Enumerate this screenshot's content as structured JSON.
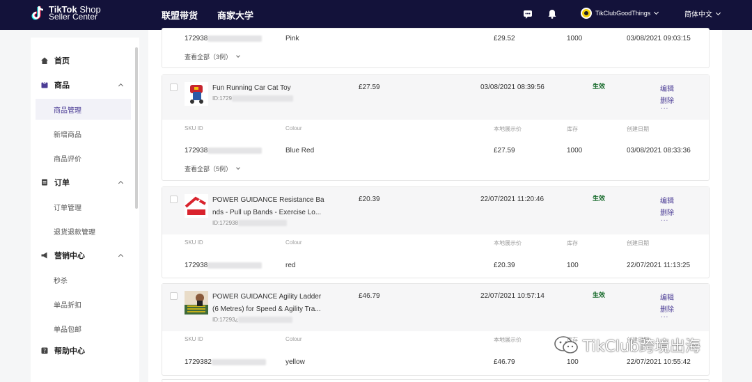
{
  "topbar": {
    "logo_line1_bold": "TikTok",
    "logo_line1_rest": " Shop",
    "logo_line2": "Seller Center",
    "nav": [
      "联盟带货",
      "商家大学"
    ],
    "account_name": "TikClubGoodThings",
    "language": "简体中文",
    "icons": [
      "message-icon",
      "bell-icon"
    ]
  },
  "sidebar": {
    "groups": [
      {
        "label": "首页",
        "icon": "home-icon"
      },
      {
        "label": "商品",
        "icon": "product-icon"
      },
      {
        "label": "订单",
        "icon": "order-icon"
      },
      {
        "label": "营销中心",
        "icon": "marketing-icon"
      },
      {
        "label": "帮助中心",
        "icon": "help-icon"
      }
    ],
    "subs": [
      "商品管理",
      "新增商品",
      "商品评价",
      "订单管理",
      "退货退款管理",
      "秒杀",
      "单品折扣",
      "单品包邮"
    ]
  },
  "table": {
    "sku_headers": [
      "SKU ID",
      "Colour",
      "本地展示价",
      "库存",
      "创建日期"
    ],
    "top_partial": {
      "sku_id": "172938",
      "colour": "Pink",
      "price": "£29.52",
      "stock": "1000",
      "created": "03/08/2021 09:03:15",
      "view_all": "查看全部（3例）"
    },
    "products": [
      {
        "name": "Fun Running Car Cat Toy",
        "id_prefix": "ID:1729",
        "price": "£27.59",
        "updated": "03/08/2021 08:39:56",
        "status": "生效",
        "edit": "编辑",
        "delete": "删除",
        "more": "...",
        "sku_id": "172938",
        "colour": "Blue Red",
        "sku_price": "£27.59",
        "stock": "1000",
        "created": "03/08/2021 08:33:36",
        "view_all": "查看全部（5例）"
      },
      {
        "name_line1": "POWER GUIDANCE Resistance Ba",
        "name_line2": "nds - Pull up Bands - Exercise Lo...",
        "id_prefix": "ID:172938",
        "price": "£20.39",
        "updated": "22/07/2021 11:20:46",
        "status": "生效",
        "edit": "编辑",
        "delete": "删除",
        "more": "...",
        "sku_id": "172938",
        "colour": "red",
        "sku_price": "£20.39",
        "stock": "100",
        "created": "22/07/2021 11:13:25"
      },
      {
        "name_line1": "POWER GUIDANCE Agility Ladder",
        "name_line2": "(6 Metres) for Speed & Agility Tra...",
        "id_prefix": "ID:17293¿",
        "price": "£46.79",
        "updated": "22/07/2021 10:57:14",
        "status": "生效",
        "edit": "编辑",
        "delete": "删除",
        "more": "...",
        "sku_id": "1729382",
        "colour": "yellow",
        "sku_price": "£46.79",
        "stock": "100",
        "created": "22/07/2021 10:55:42"
      }
    ]
  },
  "watermark": "TikClub跨境出海",
  "colors": {
    "topbar": "#13123a",
    "accent": "#4b3c95",
    "status": "#1b6d2f"
  }
}
